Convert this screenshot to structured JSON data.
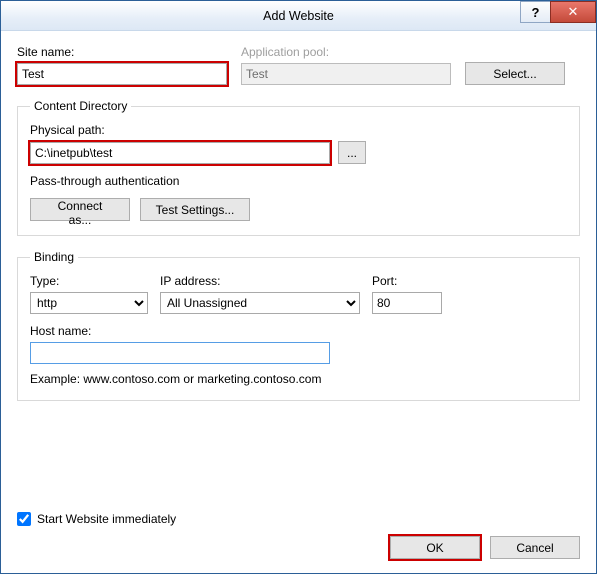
{
  "window": {
    "title": "Add Website"
  },
  "titlebar": {
    "help": "?",
    "close": "✕"
  },
  "labels": {
    "siteName": "Site name:",
    "appPool": "Application pool:",
    "contentDirectory": "Content Directory",
    "physicalPath": "Physical path:",
    "passThrough": "Pass-through authentication",
    "binding": "Binding",
    "type": "Type:",
    "ipAddress": "IP address:",
    "port": "Port:",
    "hostName": "Host name:",
    "example": "Example: www.contoso.com or marketing.contoso.com",
    "startImmediately": "Start Website immediately"
  },
  "values": {
    "siteName": "Test",
    "appPool": "Test",
    "physicalPath": "C:\\inetpub\\test",
    "type": "http",
    "ipAddress": "All Unassigned",
    "port": "80",
    "hostName": "",
    "startImmediately": true
  },
  "buttons": {
    "select": "Select...",
    "browse": "...",
    "connectAs": "Connect as...",
    "testSettings": "Test Settings...",
    "ok": "OK",
    "cancel": "Cancel"
  }
}
